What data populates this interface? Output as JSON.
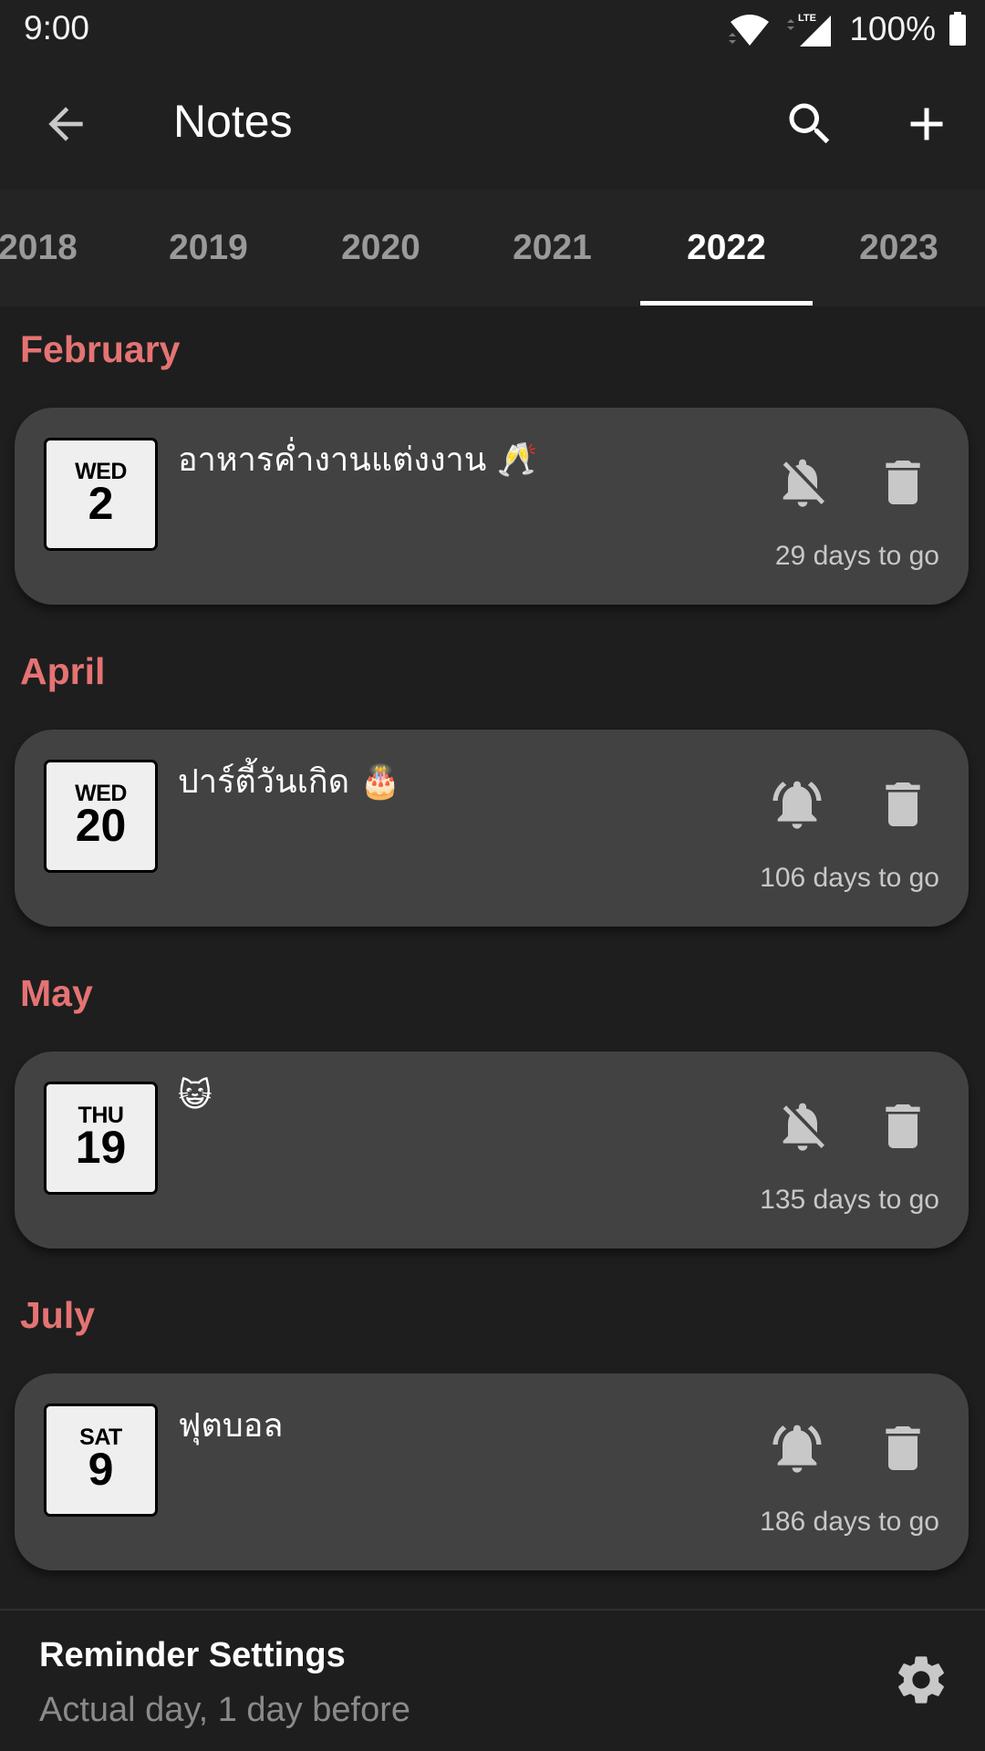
{
  "status_bar": {
    "time": "9:00",
    "network_label": "LTE",
    "battery_percent": "100%",
    "icons": [
      "wifi-icon",
      "lte-signal-icon",
      "battery-icon"
    ]
  },
  "app_bar": {
    "title": "Notes",
    "back_icon": "arrow-left-icon",
    "search_icon": "search-icon",
    "add_icon": "plus-icon"
  },
  "year_tabs": {
    "tabs": [
      {
        "label": "2018",
        "active": false
      },
      {
        "label": "2019",
        "active": false
      },
      {
        "label": "2020",
        "active": false
      },
      {
        "label": "2021",
        "active": false
      },
      {
        "label": "2022",
        "active": true
      },
      {
        "label": "2023",
        "active": false
      }
    ],
    "selected": "2022"
  },
  "sections": [
    {
      "month": "February",
      "notes": [
        {
          "dow": "WED",
          "day": "2",
          "title": "อาหารค่ำงานแต่งงาน 🥂",
          "alarm": "off",
          "countdown": "29 days to go"
        }
      ]
    },
    {
      "month": "April",
      "notes": [
        {
          "dow": "WED",
          "day": "20",
          "title": "ปาร์ตี้วันเกิด 🎂",
          "alarm": "on",
          "countdown": "106 days to go"
        }
      ]
    },
    {
      "month": "May",
      "notes": [
        {
          "dow": "THU",
          "day": "19",
          "title": "😺",
          "alarm": "off",
          "countdown": "135 days to go"
        }
      ]
    },
    {
      "month": "July",
      "notes": [
        {
          "dow": "SAT",
          "day": "9",
          "title": "ฟุตบอล",
          "alarm": "on",
          "countdown": "186 days to go"
        }
      ]
    }
  ],
  "reminder_settings": {
    "title": "Reminder Settings",
    "subtitle": "Actual day, 1 day before",
    "icon": "gear-icon"
  },
  "colors": {
    "accent_month": "#e57373",
    "card_bg": "#424242",
    "page_bg": "#1e1e1e",
    "toolbar_bg": "#202020",
    "icon_gray": "#c8c8c8"
  }
}
